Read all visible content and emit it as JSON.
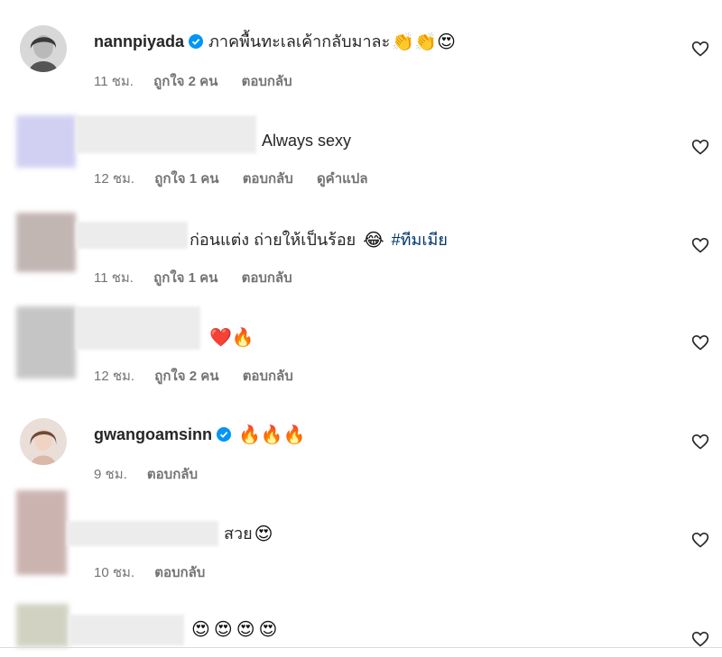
{
  "comments": [
    {
      "username": "nannpiyada",
      "verified": true,
      "text": "ภาคพื้นทะเลเค้ากลับมาละ",
      "emojis": "👏👏😍",
      "time": "11 ชม.",
      "likes": "ถูกใจ 2 คน",
      "reply": "ตอบกลับ"
    },
    {
      "username": "",
      "text": "Always sexy",
      "time": "12 ชม.",
      "likes": "ถูกใจ 1 คน",
      "reply": "ตอบกลับ",
      "translate": "ดูคำแปล"
    },
    {
      "username": "",
      "text": "ก่อนแต่ง ถ่ายให้เป็นร้อย",
      "emojis": "😂",
      "hashtag": "#ทีมเมีย",
      "time": "11 ชม.",
      "likes": "ถูกใจ 1 คน",
      "reply": "ตอบกลับ"
    },
    {
      "username": "",
      "emojis": "❤️🔥",
      "time": "12 ชม.",
      "likes": "ถูกใจ 2 คน",
      "reply": "ตอบกลับ"
    },
    {
      "username": "gwangoamsinn",
      "verified": true,
      "emojis": "🔥🔥🔥",
      "time": "9 ชม.",
      "reply": "ตอบกลับ"
    },
    {
      "username": "",
      "text": "สวย",
      "emojis": "😍",
      "time": "10 ชม.",
      "reply": "ตอบกลับ"
    },
    {
      "username": "",
      "emojis": "😍😍😍😍"
    }
  ],
  "colors": {
    "verified": "#0095f6",
    "meta": "#737373",
    "hashtag": "#00376b"
  },
  "icons": {
    "like": "heart-outline-icon",
    "verified": "verified-badge-icon"
  }
}
